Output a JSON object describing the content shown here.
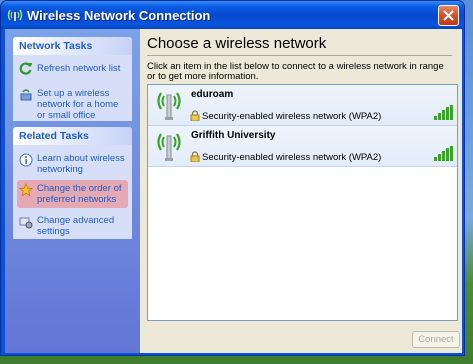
{
  "window": {
    "title": "Wireless Network Connection"
  },
  "sidebar": {
    "network_tasks": {
      "header": "Network Tasks",
      "items": [
        {
          "label": "Refresh network list",
          "icon": "refresh-icon"
        },
        {
          "label": "Set up a wireless network for a home or small office",
          "icon": "setup-wireless-icon"
        }
      ]
    },
    "related_tasks": {
      "header": "Related Tasks",
      "items": [
        {
          "label": "Learn about wireless networking",
          "icon": "info-icon"
        },
        {
          "label": "Change the order of preferred networks",
          "icon": "star-icon"
        },
        {
          "label": "Change advanced settings",
          "icon": "settings-icon"
        }
      ]
    }
  },
  "main": {
    "heading": "Choose a wireless network",
    "description": "Click an item in the list below to connect to a wireless network in range or to get more information.",
    "networks": [
      {
        "name": "eduroam",
        "security": "Security-enabled wireless network (WPA2)",
        "signal": 5
      },
      {
        "name": "Griffith University",
        "security": "Security-enabled wireless network (WPA2)",
        "signal": 5
      }
    ],
    "connect_label": "Connect"
  },
  "colors": {
    "titlebar": "#0a5ee6",
    "sidebar_link": "#215dc6",
    "selected_task_bg": "#e5a9b3",
    "signal_green": "#3aa32a"
  }
}
